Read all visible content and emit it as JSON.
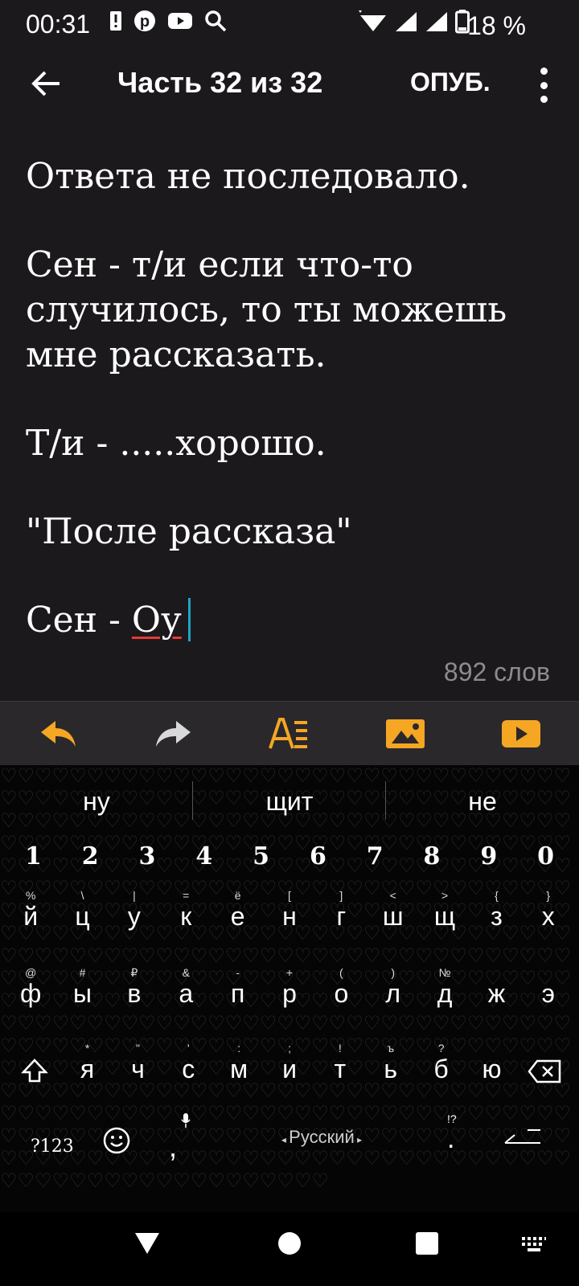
{
  "status_bar": {
    "time": "00:31",
    "battery": "18 %"
  },
  "app_bar": {
    "title": "Часть 32 из 32",
    "publish_label": "ОПУБ."
  },
  "editor": {
    "paragraphs": [
      "Ответа не последовало.",
      "Сен - т/и если что-то случилось, то ты можешь мне рассказать.",
      "Т/и - .....хорошо.",
      "\"После рассказа\""
    ],
    "last_line_prefix": "Сен - ",
    "last_line_word": "Оу",
    "word_count": "892 слов"
  },
  "toolbar": {
    "icons": [
      "undo-icon",
      "redo-icon",
      "text-format-icon",
      "insert-image-icon",
      "insert-video-icon"
    ],
    "accent_color": "#f5a623"
  },
  "keyboard": {
    "suggestions": [
      "ну",
      "щит",
      "не"
    ],
    "number_row": [
      "1",
      "2",
      "3",
      "4",
      "5",
      "6",
      "7",
      "8",
      "9",
      "0"
    ],
    "row1": {
      "keys": [
        "й",
        "ц",
        "у",
        "к",
        "е",
        "н",
        "г",
        "ш",
        "щ",
        "з",
        "х"
      ],
      "hints": [
        "%",
        "\\",
        "|",
        "=",
        "ё",
        "[",
        "]",
        "<",
        ">",
        "{",
        "}"
      ]
    },
    "row2": {
      "keys": [
        "ф",
        "ы",
        "в",
        "а",
        "п",
        "р",
        "о",
        "л",
        "д",
        "ж",
        "э"
      ],
      "hints": [
        "@",
        "#",
        "₽",
        "&",
        "-",
        "+",
        "(",
        ")",
        "№",
        "",
        ""
      ]
    },
    "row3": {
      "keys": [
        "я",
        "ч",
        "с",
        "м",
        "и",
        "т",
        "ь",
        "б",
        "ю"
      ],
      "hints": [
        "*",
        "\"",
        "'",
        ":",
        ";",
        "!",
        "ъ",
        "?",
        ""
      ]
    },
    "symbols_label": "?123",
    "comma": ",",
    "space_label": "Русский",
    "period": ".",
    "period_hint": "!?"
  }
}
